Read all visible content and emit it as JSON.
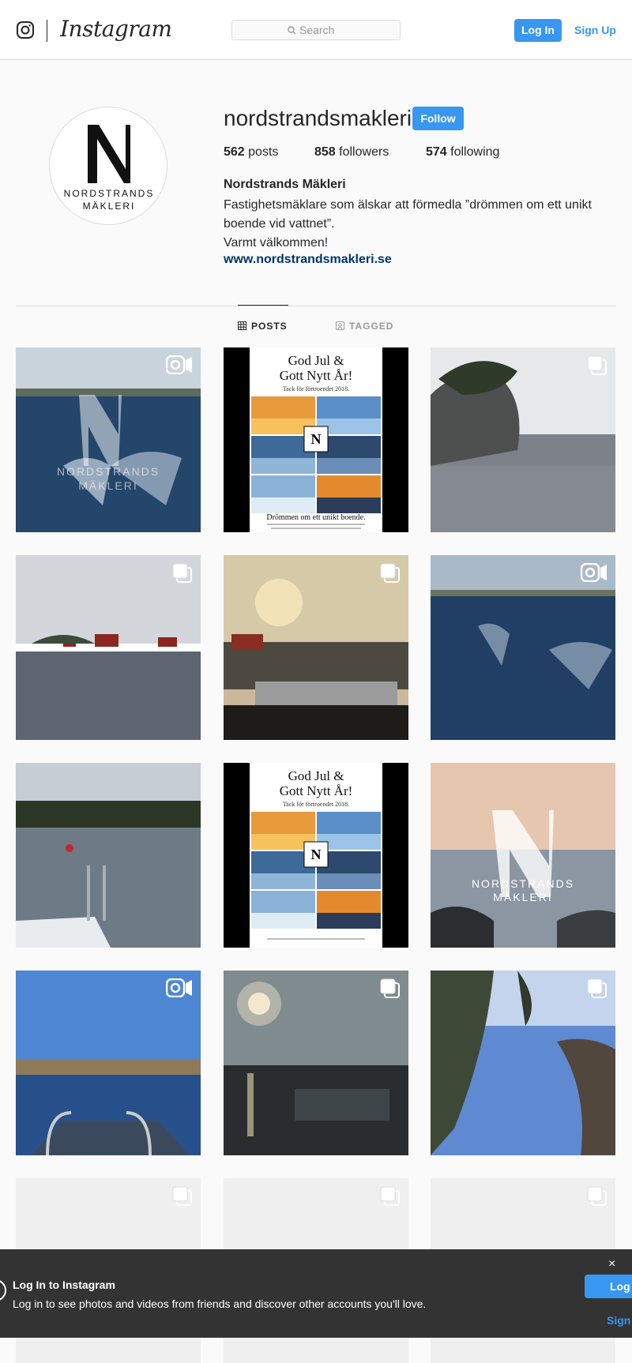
{
  "header": {
    "brand": "Instagram",
    "search_placeholder": "Search",
    "login_label": "Log In",
    "signup_label": "Sign Up"
  },
  "profile": {
    "username": "nordstrandsmakleri",
    "follow_label": "Follow",
    "avatar_line1": "NORDSTRANDS",
    "avatar_line2": "MÄKLERI",
    "posts_count": "562",
    "posts_label": "posts",
    "followers_count": "858",
    "followers_label": "followers",
    "following_count": "574",
    "following_label": "following",
    "full_name": "Nordstrands Mäkleri",
    "bio_line1": "Fastighetsmäklare som älskar att förmedla ”drömmen om ett unikt boende vid vattnet”.",
    "bio_line2": "Varmt välkommen!",
    "website": "www.nordstrandsmakleri.se"
  },
  "tabs": [
    {
      "label": "POSTS",
      "active": true
    },
    {
      "label": "TAGGED",
      "active": false
    }
  ],
  "posts": [
    {
      "badge": "video",
      "overlay1": "NORDSTRANDS",
      "overlay2": "MÄKLERI"
    },
    {
      "badge": "none",
      "title1": "God Jul &",
      "title2": "Gott Nytt År!",
      "subtitle": "Tack för förtroendet 2018.",
      "footer": "Drömmen om ett unikt boende."
    },
    {
      "badge": "carousel"
    },
    {
      "badge": "carousel"
    },
    {
      "badge": "carousel"
    },
    {
      "badge": "video"
    },
    {
      "badge": "none"
    },
    {
      "badge": "none",
      "title1": "God Jul &",
      "title2": "Gott Nytt År!",
      "subtitle": "Tack för förtroendet 2018."
    },
    {
      "badge": "none",
      "overlay1": "NORDSTRANDS",
      "overlay2": "MÄKLERI"
    },
    {
      "badge": "video"
    },
    {
      "badge": "carousel"
    },
    {
      "badge": "carousel"
    },
    {
      "badge": "carousel"
    },
    {
      "badge": "carousel"
    },
    {
      "badge": "carousel"
    }
  ],
  "banner": {
    "title": "Log In to Instagram",
    "text": "Log in to see photos and videos from friends and discover other accounts you'll love.",
    "close": "×",
    "login_label": "Log",
    "signup_label": "Sign"
  },
  "colors": {
    "accent": "#3897f0",
    "link": "#003569",
    "banner_bg": "#333333"
  }
}
